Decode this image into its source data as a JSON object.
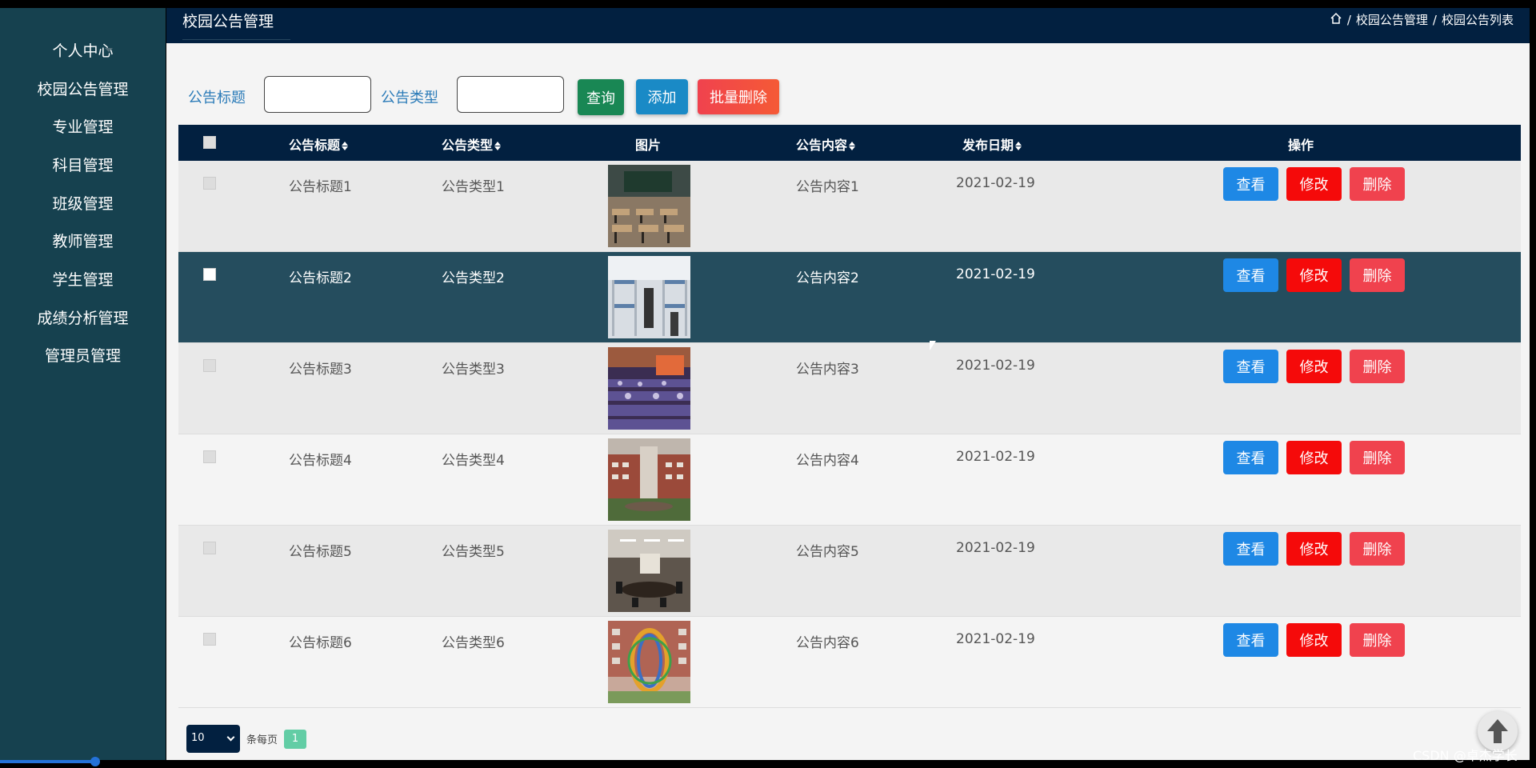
{
  "sidebar": {
    "items": [
      {
        "label": "个人中心"
      },
      {
        "label": "校园公告管理"
      },
      {
        "label": "专业管理"
      },
      {
        "label": "科目管理"
      },
      {
        "label": "班级管理"
      },
      {
        "label": "教师管理"
      },
      {
        "label": "学生管理"
      },
      {
        "label": "成绩分析管理"
      },
      {
        "label": "管理员管理"
      }
    ]
  },
  "header": {
    "title": "校园公告管理",
    "breadcrumb": [
      "校园公告管理",
      "校园公告列表"
    ],
    "breadcrumb_sep": "/"
  },
  "search": {
    "title_label": "公告标题",
    "title_value": "",
    "type_label": "公告类型",
    "type_value": "",
    "query_button": "查询",
    "add_button": "添加",
    "batch_delete_button": "批量删除"
  },
  "table": {
    "columns": [
      "公告标题",
      "公告类型",
      "图片",
      "公告内容",
      "发布日期",
      "操作"
    ],
    "rows": [
      {
        "title": "公告标题1",
        "type": "公告类型1",
        "image": "classroom-photo",
        "content": "公告内容1",
        "date": "2021-02-19"
      },
      {
        "title": "公告标题2",
        "type": "公告类型2",
        "image": "dormitory-photo",
        "content": "公告内容2",
        "date": "2021-02-19"
      },
      {
        "title": "公告标题3",
        "type": "公告类型3",
        "image": "auditorium-photo",
        "content": "公告内容3",
        "date": "2021-02-19"
      },
      {
        "title": "公告标题4",
        "type": "公告类型4",
        "image": "campus-building-photo",
        "content": "公告内容4",
        "date": "2021-02-19"
      },
      {
        "title": "公告标题5",
        "type": "公告类型5",
        "image": "meeting-room-photo",
        "content": "公告内容5",
        "date": "2021-02-19"
      },
      {
        "title": "公告标题6",
        "type": "公告类型6",
        "image": "sculpture-photo",
        "content": "公告内容6",
        "date": "2021-02-19"
      }
    ],
    "actions": {
      "view": "查看",
      "edit": "修改",
      "delete": "删除"
    }
  },
  "pager": {
    "page_size": "10",
    "per_page_label": "条每页",
    "current_page": "1"
  },
  "watermark": "CSDN @卓杰学长",
  "colors": {
    "sidebar": "#16414f",
    "header": "#022040",
    "view_button": "#1e88e5",
    "edit_button": "#f50a0a",
    "delete_button": "#f0424e",
    "query_button": "#198754",
    "add_button": "#1a8ac6",
    "highlight_row": "#254d5e"
  },
  "icons": {
    "breadcrumb_home": "home-icon",
    "back_to_top": "arrow-up-icon"
  }
}
